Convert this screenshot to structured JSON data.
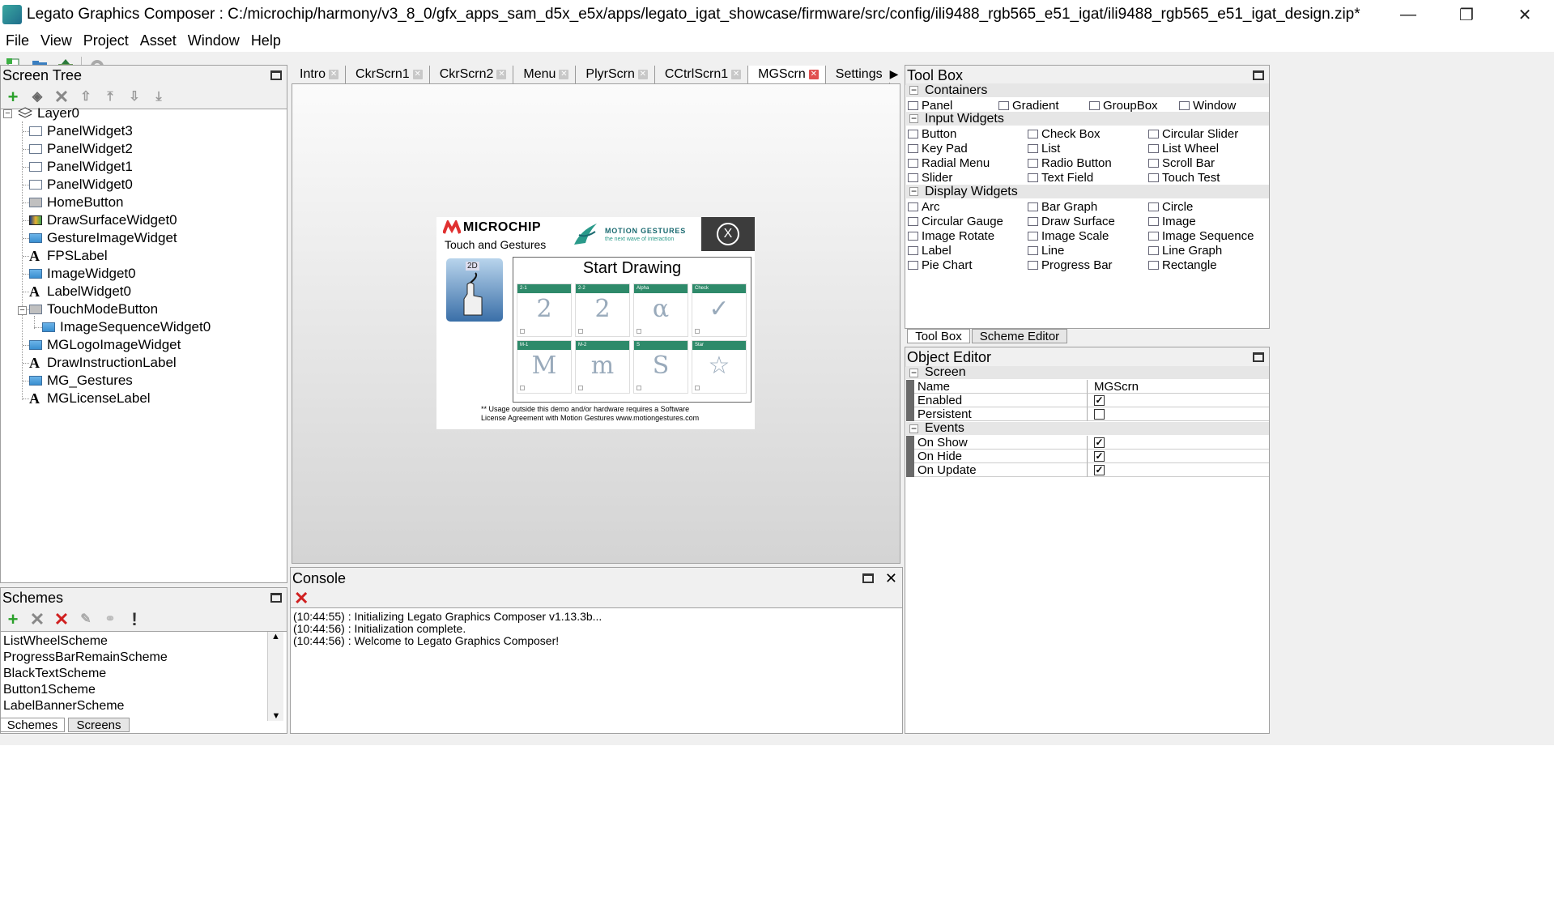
{
  "window": {
    "title": "Legato Graphics Composer : C:/microchip/harmony/v3_8_0/gfx_apps_sam_d5x_e5x/apps/legato_igat_showcase/firmware/src/config/ili9488_rgb565_e51_igat/ili9488_rgb565_e51_igat_design.zip*",
    "minimize": "—",
    "maximize": "❐",
    "close": "✕"
  },
  "menu": [
    "File",
    "View",
    "Project",
    "Asset",
    "Window",
    "Help"
  ],
  "screen_tree": {
    "header": "Screen Tree",
    "root": "Layer0",
    "items": [
      {
        "label": "PanelWidget3",
        "icon": "panel"
      },
      {
        "label": "PanelWidget2",
        "icon": "panel"
      },
      {
        "label": "PanelWidget1",
        "icon": "panel"
      },
      {
        "label": "PanelWidget0",
        "icon": "panel"
      },
      {
        "label": "HomeButton",
        "icon": "button"
      },
      {
        "label": "DrawSurfaceWidget0",
        "icon": "draw"
      },
      {
        "label": "GestureImageWidget",
        "icon": "image"
      },
      {
        "label": "FPSLabel",
        "icon": "label"
      },
      {
        "label": "ImageWidget0",
        "icon": "image"
      },
      {
        "label": "LabelWidget0",
        "icon": "label"
      },
      {
        "label": "TouchModeButton",
        "icon": "button"
      },
      {
        "label": "ImageSequenceWidget0",
        "icon": "imgseq"
      },
      {
        "label": "MGLogoImageWidget",
        "icon": "image"
      },
      {
        "label": "DrawInstructionLabel",
        "icon": "label"
      },
      {
        "label": "MG_Gestures",
        "icon": "image"
      },
      {
        "label": "MGLicenseLabel",
        "icon": "label"
      }
    ]
  },
  "tabs": [
    {
      "label": "Intro",
      "active": false
    },
    {
      "label": "CkrScrn1",
      "active": false
    },
    {
      "label": "CkrScrn2",
      "active": false
    },
    {
      "label": "Menu",
      "active": false
    },
    {
      "label": "PlyrScrn",
      "active": false
    },
    {
      "label": "CCtrlScrn1",
      "active": false
    },
    {
      "label": "MGScrn",
      "active": true
    },
    {
      "label": "Settings",
      "active": false
    }
  ],
  "preview": {
    "brand": "MICROCHIP",
    "subtitle": "Touch and Gestures",
    "mg_brand": "MOTION GESTURES",
    "mg_tagline": "the next wave of interaction",
    "close_glyph": "X",
    "mode_badge": "2D",
    "draw_title": "Start Drawing",
    "gestures": [
      {
        "label": "2-1",
        "glyph": "2"
      },
      {
        "label": "2-2",
        "glyph": "2"
      },
      {
        "label": "Alpha",
        "glyph": "α"
      },
      {
        "label": "Check",
        "glyph": "✓"
      },
      {
        "label": "M-1",
        "glyph": "M"
      },
      {
        "label": "M-2",
        "glyph": "m"
      },
      {
        "label": "S",
        "glyph": "S"
      },
      {
        "label": "Star",
        "glyph": "☆"
      }
    ],
    "license_line1": "** Usage outside this demo and/or hardware requires a Software",
    "license_line2": "License Agreement with Motion Gestures www.motiongestures.com"
  },
  "toolbox": {
    "header": "Tool Box",
    "sections": [
      {
        "title": "Containers",
        "items": [
          "Panel",
          "Gradient",
          "GroupBox",
          "Window"
        ]
      },
      {
        "title": "Input Widgets",
        "items": [
          "Button",
          "Check Box",
          "Circular Slider",
          "Key Pad",
          "List",
          "List Wheel",
          "Radial Menu",
          "Radio Button",
          "Scroll Bar",
          "Slider",
          "Text Field",
          "Touch Test"
        ]
      },
      {
        "title": "Display Widgets",
        "items": [
          "Arc",
          "Bar Graph",
          "Circle",
          "Circular Gauge",
          "Draw Surface",
          "Image",
          "Image Rotate",
          "Image Scale",
          "Image Sequence",
          "Label",
          "Line",
          "Line Graph",
          "Pie Chart",
          "Progress Bar",
          "Rectangle"
        ]
      }
    ],
    "tabs": [
      "Tool Box",
      "Scheme Editor"
    ]
  },
  "object_editor": {
    "header": "Object Editor",
    "screen_section": "Screen",
    "rows": [
      {
        "name": "Name",
        "value": "MGScrn"
      },
      {
        "name": "Enabled",
        "checked": true
      },
      {
        "name": "Persistent",
        "checked": false
      }
    ],
    "events_section": "Events",
    "events": [
      {
        "name": "On Show",
        "checked": true
      },
      {
        "name": "On Hide",
        "checked": true
      },
      {
        "name": "On Update",
        "checked": true
      }
    ]
  },
  "console": {
    "header": "Console",
    "lines": [
      "(10:44:55) : Initializing Legato Graphics Composer v1.13.3b...",
      "(10:44:56) : Initialization complete.",
      "(10:44:56) : Welcome to Legato Graphics Composer!"
    ]
  },
  "schemes": {
    "header": "Schemes",
    "items": [
      "ListWheelScheme",
      "ProgressBarRemainScheme",
      "BlackTextScheme",
      "Button1Scheme",
      "LabelBannerScheme"
    ],
    "tabs": [
      "Schemes",
      "Screens"
    ]
  }
}
